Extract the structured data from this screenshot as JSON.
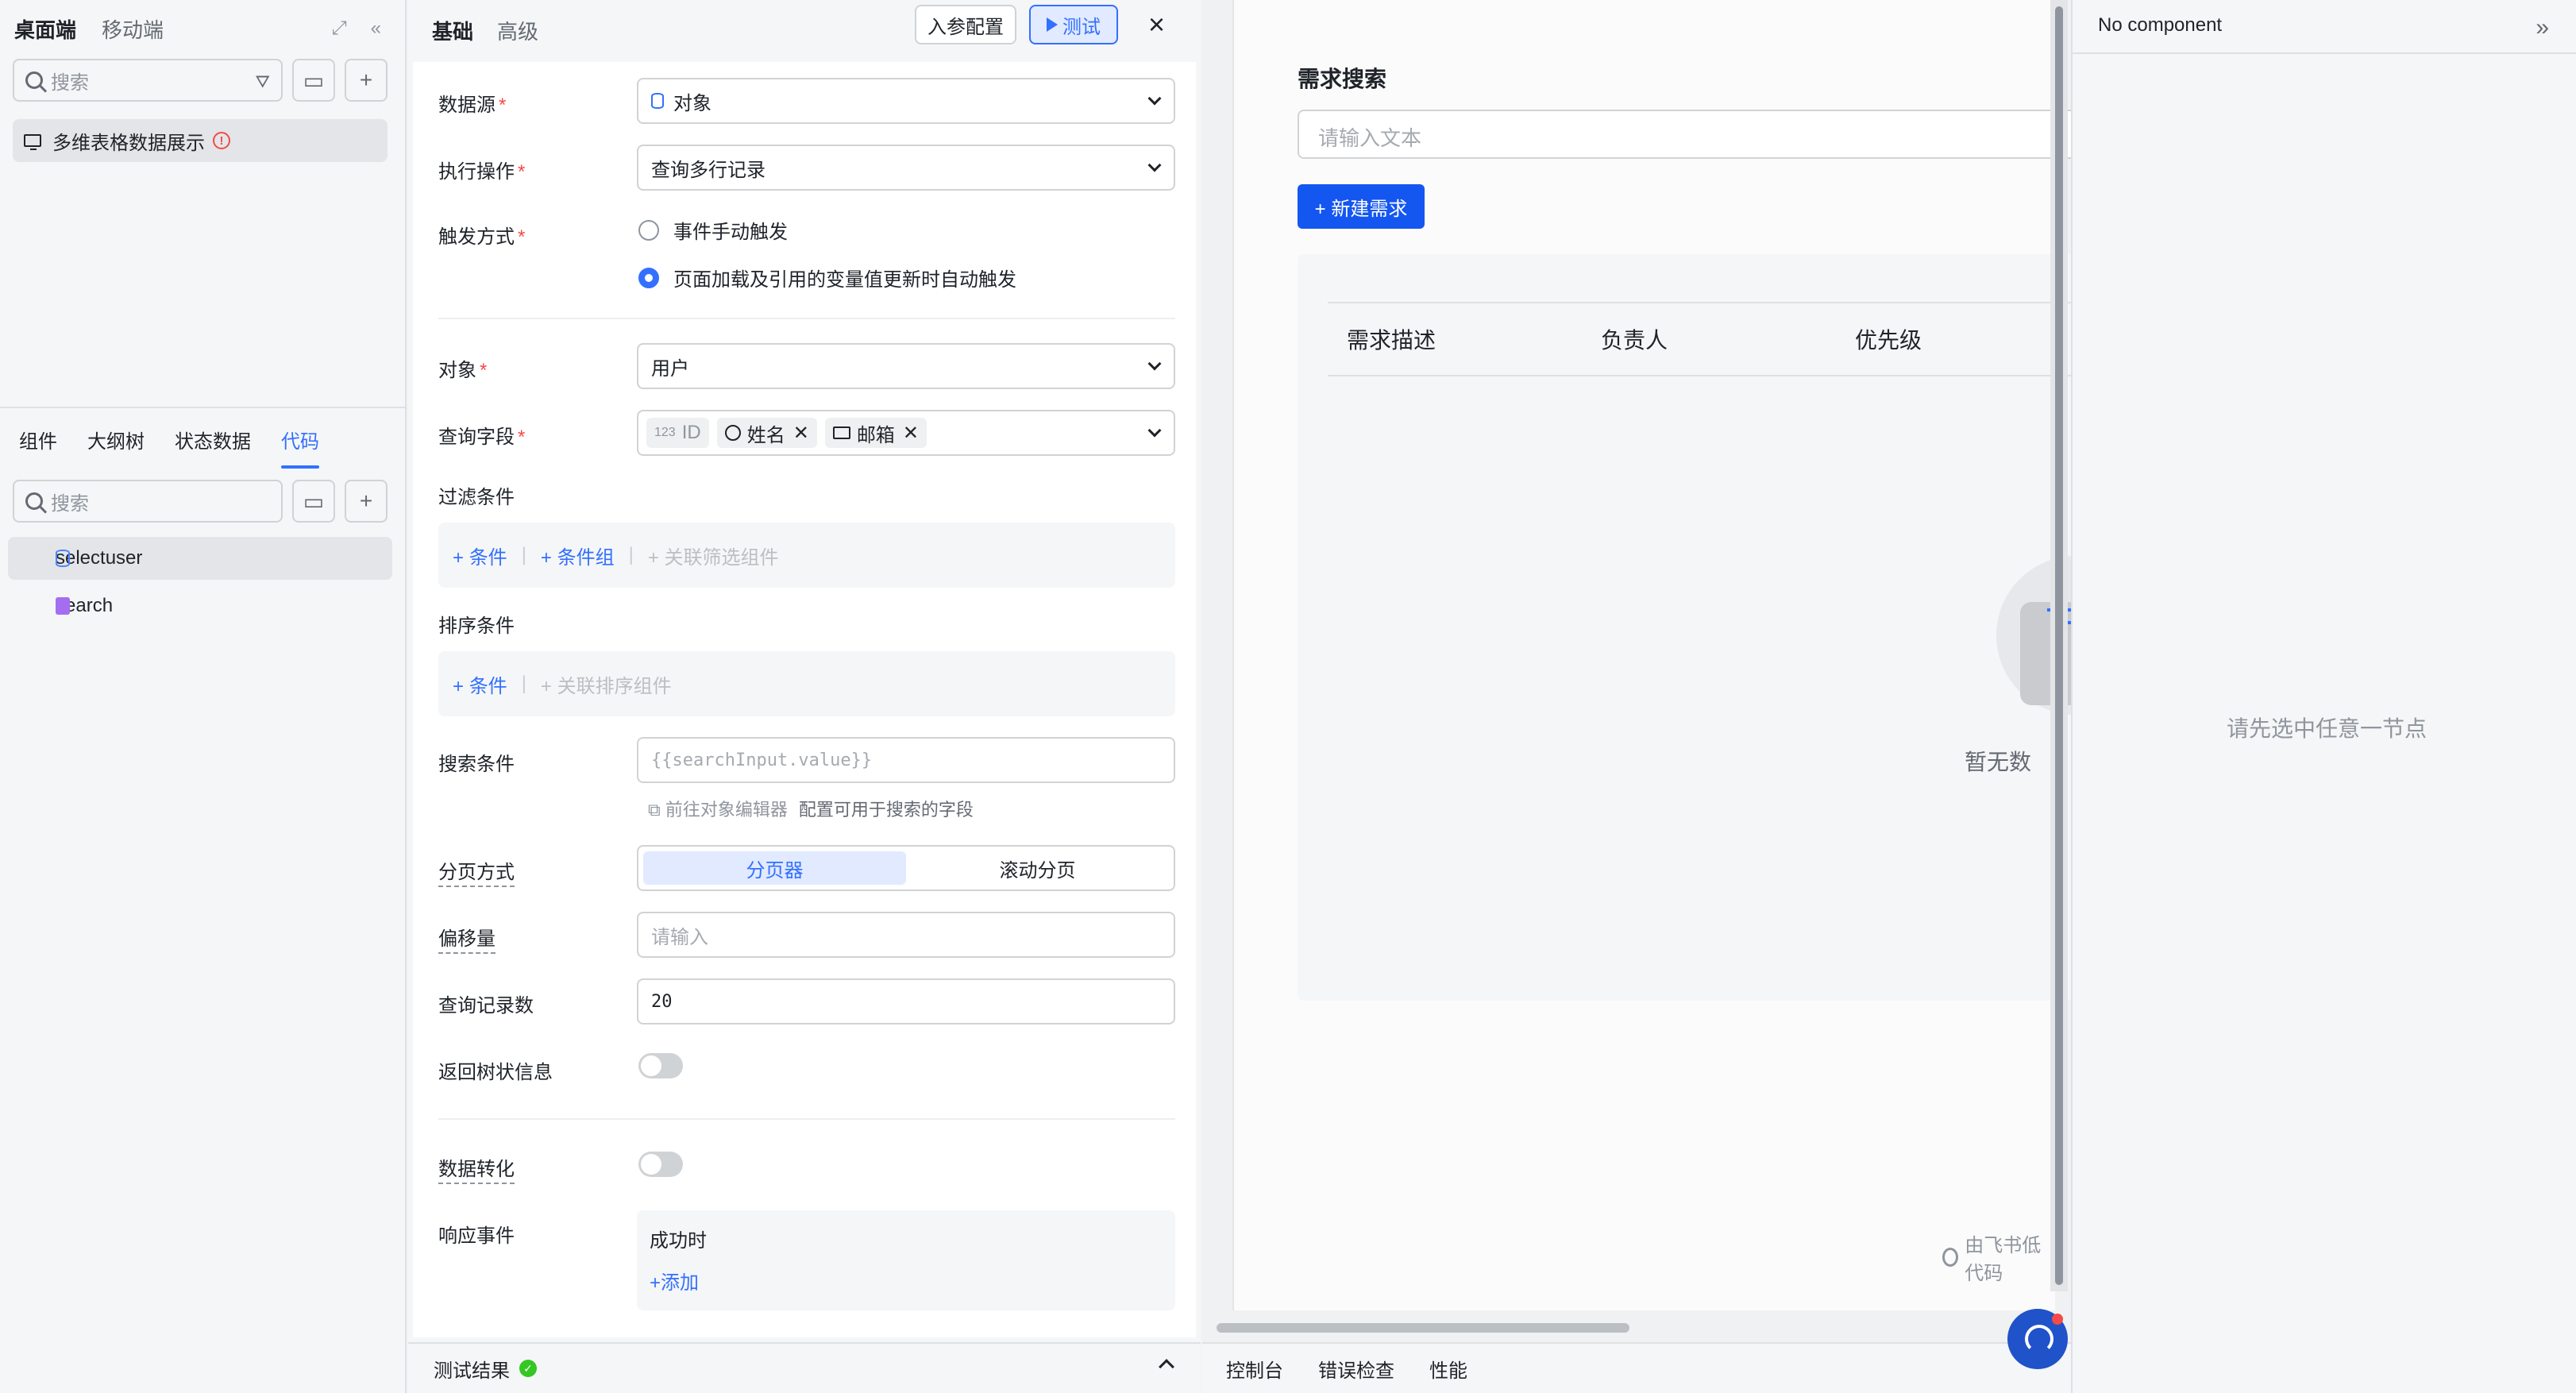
{
  "left": {
    "tabs": [
      "桌面端",
      "移动端"
    ],
    "search_placeholder": "搜索",
    "page_item": "多维表格数据展示",
    "panel_tabs": [
      "组件",
      "大纲树",
      "状态数据",
      "代码"
    ],
    "code_search_placeholder": "搜索",
    "code_items": [
      "selectuser",
      "search"
    ]
  },
  "config": {
    "tabs": [
      "基础",
      "高级"
    ],
    "param_button": "入参配置",
    "test_button": "测试",
    "datasource_label": "数据源",
    "datasource_value": "对象",
    "operation_label": "执行操作",
    "operation_value": "查询多行记录",
    "trigger_label": "触发方式",
    "trigger_options": [
      "事件手动触发",
      "页面加载及引用的变量值更新时自动触发"
    ],
    "object_label": "对象",
    "object_value": "用户",
    "fields_label": "查询字段",
    "fields": [
      {
        "num": "123",
        "name": "ID"
      },
      {
        "name": "姓名"
      },
      {
        "name": "邮箱"
      }
    ],
    "filter_label": "过滤条件",
    "filter_links": [
      "条件",
      "条件组",
      "关联筛选组件"
    ],
    "sort_label": "排序条件",
    "sort_links": [
      "条件",
      "关联排序组件"
    ],
    "search_label": "搜索条件",
    "search_value": "{{searchInput.value}}",
    "search_hint_link": "前往对象编辑器",
    "search_hint_text": "配置可用于搜索的字段",
    "paging_label": "分页方式",
    "paging_options": [
      "分页器",
      "滚动分页"
    ],
    "offset_label": "偏移量",
    "offset_placeholder": "请输入",
    "count_label": "查询记录数",
    "count_value": "20",
    "tree_label": "返回树状信息",
    "transform_label": "数据转化",
    "events_label": "响应事件",
    "events_success": "成功时",
    "events_add": "添加",
    "test_result": "测试结果"
  },
  "canvas": {
    "title": "需求搜索",
    "input_placeholder": "请输入文本",
    "new_button": "+ 新建需求",
    "table_headers": [
      "需求描述",
      "负责人",
      "优先级"
    ],
    "empty_text": "暂无数",
    "brand": "由飞书低代码"
  },
  "console_tabs": [
    "控制台",
    "错误检查",
    "性能"
  ],
  "right": {
    "title": "No component",
    "empty": "请先选中任意一节点"
  }
}
